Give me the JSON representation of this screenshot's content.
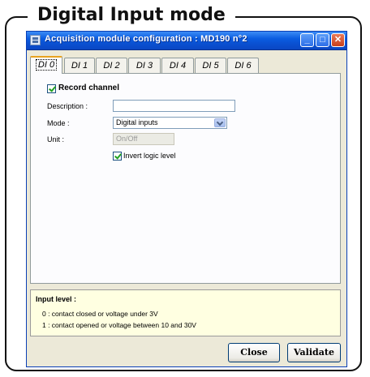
{
  "frame": {
    "title": "Digital Input mode"
  },
  "window": {
    "title": "Acquisition module configuration : MD190 n°2",
    "controls": {
      "minimize": "_",
      "maximize": "□",
      "close": "✕"
    }
  },
  "tabs": [
    {
      "label": "DI 0",
      "active": true
    },
    {
      "label": "DI 1"
    },
    {
      "label": "DI 2"
    },
    {
      "label": "DI 3"
    },
    {
      "label": "DI 4"
    },
    {
      "label": "DI 5"
    },
    {
      "label": "DI 6"
    }
  ],
  "form": {
    "record_channel": {
      "label": "Record channel",
      "checked": true
    },
    "description": {
      "label": "Description :",
      "value": ""
    },
    "mode": {
      "label": "Mode :",
      "value": "Digital inputs"
    },
    "unit": {
      "label": "Unit :",
      "value": "On/Off"
    },
    "invert": {
      "label": "Invert logic level",
      "checked": true
    }
  },
  "info": {
    "title": "Input level :",
    "lines": [
      "0 : contact closed or voltage under 3V",
      "1 : contact opened or voltage between 10 and 30V"
    ]
  },
  "buttons": {
    "close": "Close",
    "validate": "Validate"
  },
  "colors": {
    "titlebar": "#0a5ce0",
    "window_bg": "#ece9d8",
    "info_bg": "#ffffe1",
    "tab_highlight": "#e8a320"
  }
}
